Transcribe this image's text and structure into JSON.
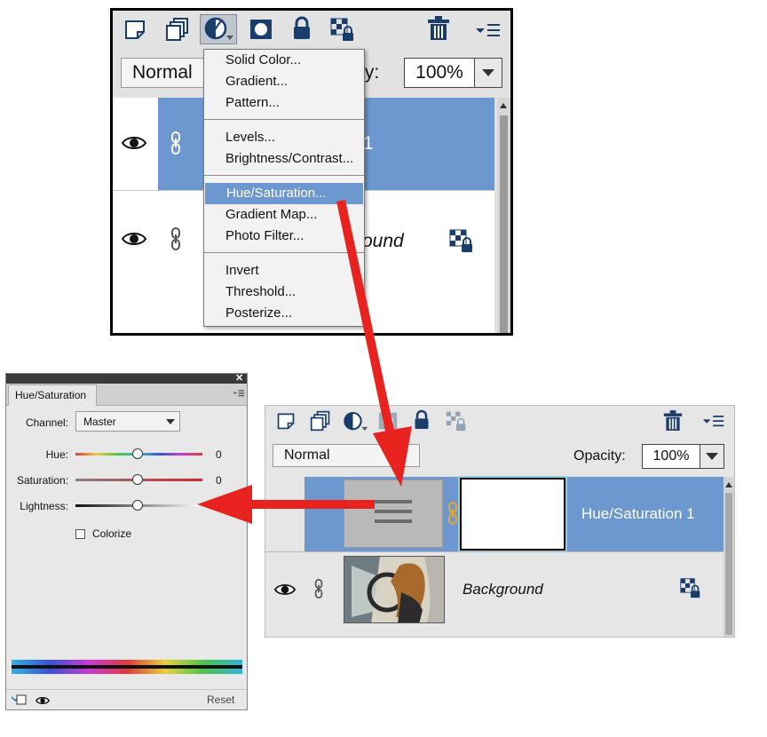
{
  "top_panel": {
    "blend_mode": "Normal",
    "opacity_label": "ty:",
    "opacity_value": "100%",
    "layer1_name_partial": "1",
    "layer2_name_partial": "round"
  },
  "adjustment_menu": {
    "items": [
      {
        "label": "Solid Color..."
      },
      {
        "label": "Gradient..."
      },
      {
        "label": "Pattern..."
      },
      {
        "label": "Levels..."
      },
      {
        "label": "Brightness/Contrast..."
      },
      {
        "label": "Hue/Saturation..."
      },
      {
        "label": "Gradient Map..."
      },
      {
        "label": "Photo Filter..."
      },
      {
        "label": "Invert"
      },
      {
        "label": "Threshold..."
      },
      {
        "label": "Posterize..."
      }
    ],
    "highlighted": "Hue/Saturation..."
  },
  "layers_panel": {
    "blend_mode": "Normal",
    "opacity_label": "Opacity:",
    "opacity_value": "100%",
    "layers": [
      {
        "name": "Hue/Saturation 1",
        "selected": true
      },
      {
        "name": "Background",
        "selected": false
      }
    ]
  },
  "properties_panel": {
    "tab_title": "Hue/Saturation",
    "channel_label": "Channel:",
    "channel_value": "Master",
    "hue_label": "Hue:",
    "hue_value": "0",
    "saturation_label": "Saturation:",
    "saturation_value": "0",
    "lightness_label": "Lightness:",
    "colorize_label": "Colorize",
    "colorize_checked": false,
    "reset_label": "Reset"
  },
  "colors": {
    "selected_layer": "#6d98cf",
    "arrow": "#e8231f",
    "menu_highlight": "#6d98cf"
  }
}
